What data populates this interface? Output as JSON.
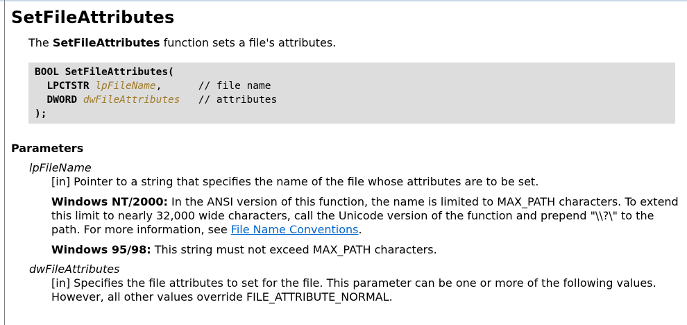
{
  "page": {
    "title": "SetFileAttributes",
    "summary": {
      "prefix": "The ",
      "func_name": "SetFileAttributes",
      "suffix": " function sets a file's attributes."
    }
  },
  "syntax": {
    "line1": "BOOL SetFileAttributes(",
    "line2_type": "  LPCTSTR ",
    "line2_param": "lpFileName",
    "line2_rest": ",      // file name",
    "line3_type": "  DWORD ",
    "line3_param": "dwFileAttributes",
    "line3_rest": "   // attributes",
    "line4": ");"
  },
  "parameters": {
    "heading": "Parameters",
    "p1": {
      "name": "lpFileName",
      "desc": "[in] Pointer to a string that specifies the name of the file whose attributes are to be set.",
      "note1_label": "Windows NT/2000:",
      "note1_text": " In the ANSI version of this function, the name is limited to MAX_PATH characters. To extend this limit to nearly 32,000 wide characters, call the Unicode version of the function and prepend \"\\\\?\\\" to the path. For more information, see ",
      "note1_link": "File Name Conventions",
      "note1_end": ".",
      "note2_label": "Windows 95/98:",
      "note2_text": " This string must not exceed MAX_PATH characters."
    },
    "p2": {
      "name": "dwFileAttributes",
      "desc": "[in] Specifies the file attributes to set for the file. This parameter can be one or more of the following values. However, all other values override FILE_ATTRIBUTE_NORMAL."
    }
  }
}
